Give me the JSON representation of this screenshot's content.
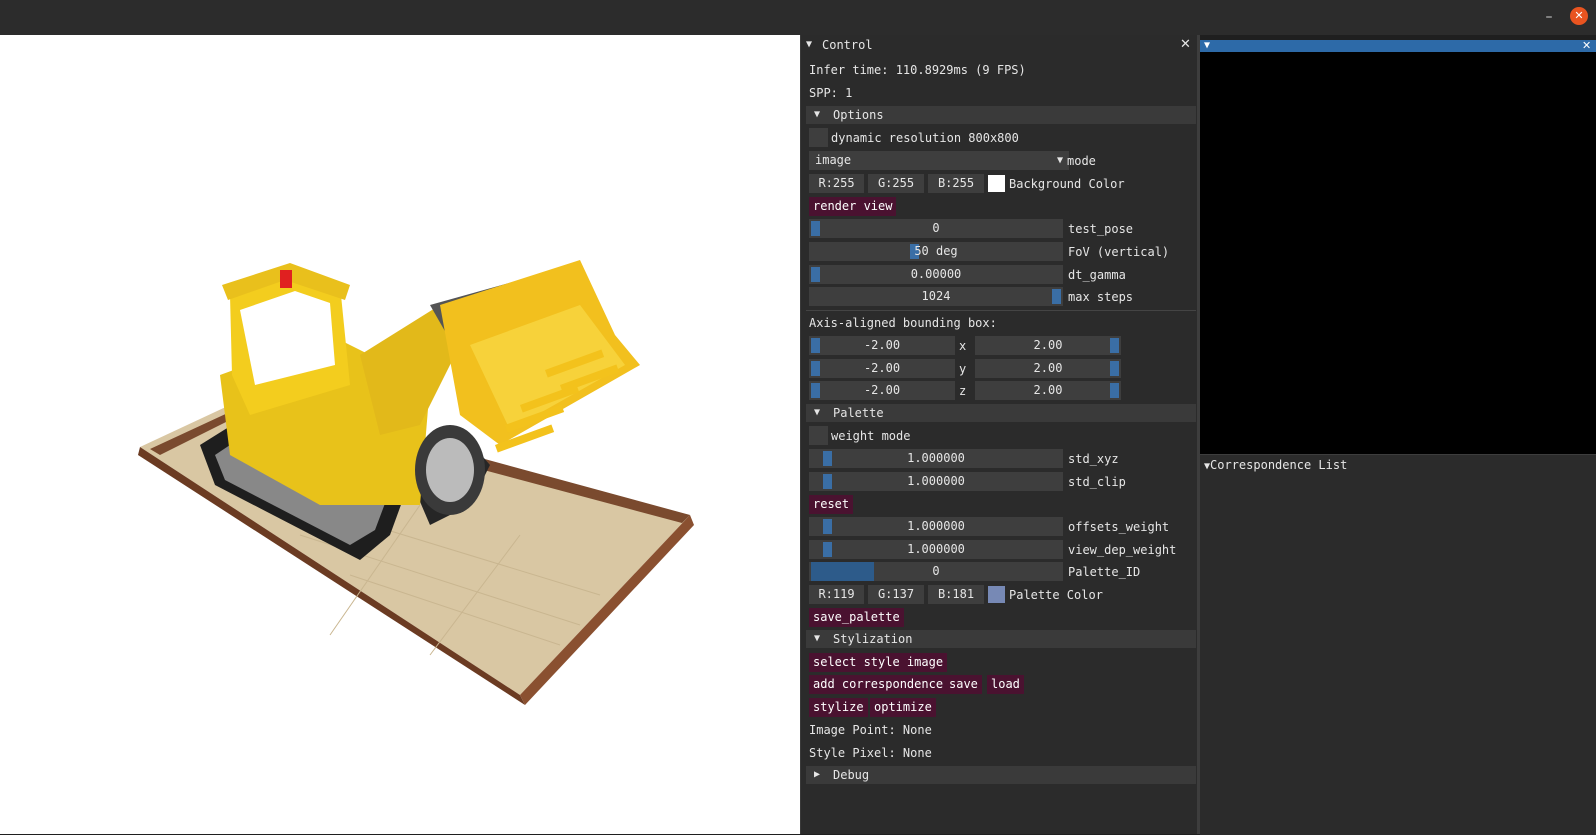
{
  "window": {
    "minimize_glyph": "–",
    "close_glyph": "✕"
  },
  "control": {
    "title": "Control",
    "infer_time": "Infer time:  110.8929ms (9 FPS)",
    "spp": "SPP:  1",
    "options": {
      "header": "Options",
      "dynamic_resolution_label": "dynamic resolution 800x800",
      "mode_value": "image",
      "mode_label": "mode",
      "bg_r": "R:255",
      "bg_g": "G:255",
      "bg_b": "B:255",
      "bg_color_label": "Background Color",
      "bg_color_hex": "#ffffff",
      "render_view_button": "render view",
      "test_pose_value": "0",
      "test_pose_label": "test_pose",
      "fov_value": "50 deg",
      "fov_label": "FoV (vertical)",
      "fov_fraction": 0.5,
      "dt_gamma_value": "0.00000",
      "dt_gamma_label": "dt_gamma",
      "max_steps_value": "1024",
      "max_steps_label": "max steps",
      "aabb_label": "Axis-aligned bounding box:",
      "aabb_x_min": "-2.00",
      "aabb_x_max": "2.00",
      "x_label": "x",
      "aabb_y_min": "-2.00",
      "aabb_y_max": "2.00",
      "y_label": "y",
      "aabb_z_min": "-2.00",
      "aabb_z_max": "2.00",
      "z_label": "z"
    },
    "palette": {
      "header": "Palette",
      "weight_mode_label": "weight mode",
      "std_xyz_value": "1.000000",
      "std_xyz_label": "std_xyz",
      "std_clip_value": "1.000000",
      "std_clip_label": "std_clip",
      "reset_button": "reset",
      "offsets_weight_value": "1.000000",
      "offsets_weight_label": "offsets_weight",
      "view_dep_weight_value": "1.000000",
      "view_dep_weight_label": "view_dep_weight",
      "palette_id_value": "0",
      "palette_id_label": "Palette_ID",
      "pal_r": "R:119",
      "pal_g": "G:137",
      "pal_b": "B:181",
      "palette_color_label": "Palette Color",
      "palette_color_hex": "#7789b5",
      "save_palette_button": "save_palette"
    },
    "stylization": {
      "header": "Stylization",
      "select_style_button": "select style image",
      "add_correspondence_button": "add correspondence",
      "save_button": "save",
      "load_button": "load",
      "stylize_button": "stylize",
      "optimize_button": "optimize",
      "image_point": "Image Point: None",
      "style_pixel": "Style Pixel: None"
    },
    "debug": {
      "header": "Debug"
    }
  },
  "correspondence": {
    "header": "Correspondence List"
  },
  "colors": {
    "accent": "#2d6aa8",
    "button": "#4a1230",
    "close": "#e95420"
  }
}
